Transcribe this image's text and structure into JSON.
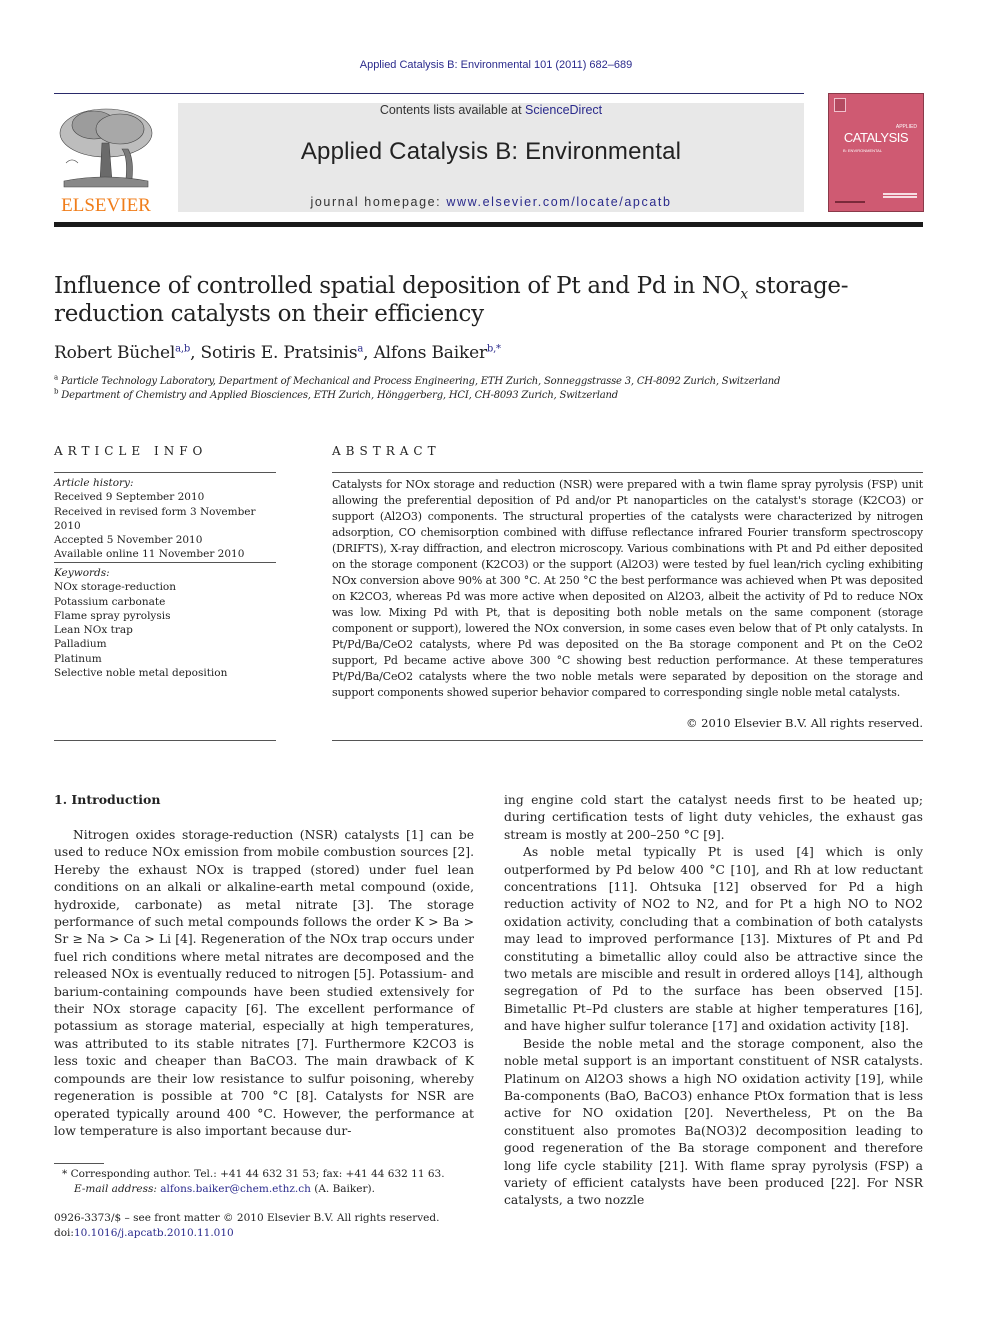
{
  "running_head": "Applied Catalysis B: Environmental 101 (2011) 682–689",
  "masthead": {
    "contents_prefix": "Contents lists available at ",
    "contents_link": "ScienceDirect",
    "journal_title": "Applied Catalysis B: Environmental",
    "homepage_prefix": "journal homepage: ",
    "homepage_link": "www.elsevier.com/locate/apcatb",
    "publisher_logo": "ELSEVIER",
    "cover_title": "CATALYSIS",
    "cover_kicker": "APPLIED",
    "cover_subtitle": "B: ENVIRONMENTAL",
    "cover_color": "#cf5a72",
    "publisher_color": "#f07d1a"
  },
  "article": {
    "title_part1": "Influence of controlled spatial deposition of Pt and Pd in NO",
    "title_sub": "x",
    "title_part2": " storage-reduction catalysts on their efficiency",
    "authors": [
      {
        "name": "Robert Büchel",
        "marks": "a,b"
      },
      {
        "name": "Sotiris E. Pratsinis",
        "marks": "a"
      },
      {
        "name": "Alfons Baiker",
        "marks": "b,*"
      }
    ],
    "affiliations": [
      {
        "mark": "a",
        "text": "Particle Technology Laboratory, Department of Mechanical and Process Engineering, ETH Zurich, Sonneggstrasse 3, CH-8092 Zurich, Switzerland"
      },
      {
        "mark": "b",
        "text": "Department of Chemistry and Applied Biosciences, ETH Zurich, Hönggerberg, HCI, CH-8093 Zurich, Switzerland"
      }
    ]
  },
  "article_info": {
    "heading": "ARTICLE INFO",
    "history_label": "Article history:",
    "history": [
      "Received 9 September 2010",
      "Received in revised form 3 November 2010",
      "Accepted 5 November 2010",
      "Available online 11 November 2010"
    ],
    "keywords_label": "Keywords:",
    "keywords": [
      "NOx storage-reduction",
      "Potassium carbonate",
      "Flame spray pyrolysis",
      "Lean NOx trap",
      "Palladium",
      "Platinum",
      "Selective noble metal deposition"
    ]
  },
  "abstract": {
    "heading": "ABSTRACT",
    "text": "Catalysts for NOx storage and reduction (NSR) were prepared with a twin flame spray pyrolysis (FSP) unit allowing the preferential deposition of Pd and/or Pt nanoparticles on the catalyst's storage (K2CO3) or support (Al2O3) components. The structural properties of the catalysts were characterized by nitrogen adsorption, CO chemisorption combined with diffuse reflectance infrared Fourier transform spectroscopy (DRIFTS), X-ray diffraction, and electron microscopy. Various combinations with Pt and Pd either deposited on the storage component (K2CO3) or the support (Al2O3) were tested by fuel lean/rich cycling exhibiting NOx conversion above 90% at 300 °C. At 250 °C the best performance was achieved when Pt was deposited on K2CO3, whereas Pd was more active when deposited on Al2O3, albeit the activity of Pd to reduce NOx was low. Mixing Pd with Pt, that is depositing both noble metals on the same component (storage component or support), lowered the NOx conversion, in some cases even below that of Pt only catalysts. In Pt/Pd/Ba/CeO2 catalysts, where Pd was deposited on the Ba storage component and Pt on the CeO2 support, Pd became active above 300 °C showing best reduction performance. At these temperatures Pt/Pd/Ba/CeO2 catalysts where the two noble metals were separated by deposition on the storage and support components showed superior behavior compared to corresponding single noble metal catalysts.",
    "copyright": "© 2010 Elsevier B.V. All rights reserved."
  },
  "introduction": {
    "heading": "1.  Introduction",
    "left_col": "Nitrogen oxides storage-reduction (NSR) catalysts [1] can be used to reduce NOx emission from mobile combustion sources [2]. Hereby the exhaust NOx is trapped (stored) under fuel lean conditions on an alkali or alkaline-earth metal compound (oxide, hydroxide, carbonate) as metal nitrate [3]. The storage performance of such metal compounds follows the order K > Ba > Sr ≥ Na > Ca > Li [4]. Regeneration of the NOx trap occurs under fuel rich conditions where metal nitrates are decomposed and the released NOx is eventually reduced to nitrogen [5]. Potassium- and barium-containing compounds have been studied extensively for their NOx storage capacity [6]. The excellent performance of potassium as storage material, especially at high temperatures, was attributed to its stable nitrates [7]. Furthermore K2CO3 is less toxic and cheaper than BaCO3. The main drawback of K compounds are their low resistance to sulfur poisoning, whereby regeneration is possible at 700 °C [8]. Catalysts for NSR are operated typically around 400 °C. However, the performance at low temperature is also important because dur-",
    "right_col_p1": "ing engine cold start the catalyst needs first to be heated up; during certification tests of light duty vehicles, the exhaust gas stream is mostly at 200–250 °C [9].",
    "right_col_p2": "As noble metal typically Pt is used [4] which is only outperformed by Pd below 400 °C [10], and Rh at low reductant concentrations [11]. Ohtsuka [12] observed for Pd a high reduction activity of NO2 to N2, and for Pt a high NO to NO2 oxidation activity, concluding that a combination of both catalysts may lead to improved performance [13]. Mixtures of Pt and Pd constituting a bimetallic alloy could also be attractive since the two metals are miscible and result in ordered alloys [14], although segregation of Pd to the surface has been observed [15]. Bimetallic Pt–Pd clusters are stable at higher temperatures [16], and have higher sulfur tolerance [17] and oxidation activity [18].",
    "right_col_p3": "Beside the noble metal and the storage component, also the noble metal support is an important constituent of NSR catalysts. Platinum on Al2O3 shows a high NO oxidation activity [19], while Ba-components (BaO, BaCO3) enhance PtOx formation that is less active for NO oxidation [20]. Nevertheless, Pt on the Ba constituent also promotes Ba(NO3)2 decomposition leading to good regeneration of the Ba storage component and therefore long life cycle stability [21]. With flame spray pyrolysis (FSP) a variety of efficient catalysts have been produced [22]. For NSR catalysts, a two nozzle"
  },
  "footnotes": {
    "corresponding": "* Corresponding author. Tel.: +41 44 632 31 53; fax: +41 44 632 11 63.",
    "email_label": "E-mail address: ",
    "email": "alfons.baiker@chem.ethz.ch",
    "email_suffix": " (A. Baiker).",
    "front_matter": "0926-3373/$ – see front matter © 2010 Elsevier B.V. All rights reserved.",
    "doi_label": "doi:",
    "doi": "10.1016/j.apcatb.2010.11.010"
  }
}
